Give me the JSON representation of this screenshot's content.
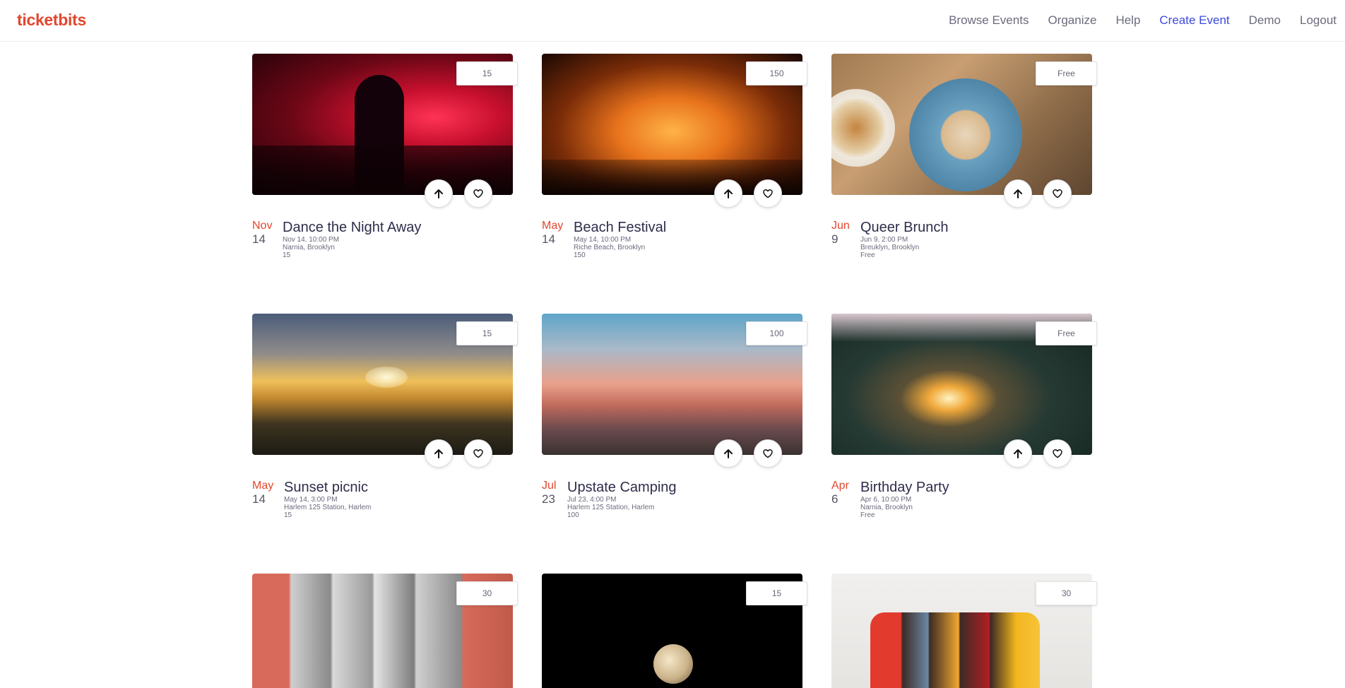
{
  "app": {
    "brand": "ticketbits"
  },
  "nav": {
    "items": [
      {
        "label": "Browse Events"
      },
      {
        "label": "Organize"
      },
      {
        "label": "Help"
      },
      {
        "label": "Create Event",
        "active": true
      },
      {
        "label": "Demo"
      },
      {
        "label": "Logout"
      }
    ]
  },
  "colors": {
    "brand": "#e2472f",
    "active_nav": "#3d4ad8",
    "title": "#2d2d4a"
  },
  "events": [
    {
      "month": "Nov",
      "day": "14",
      "title": "Dance the Night Away",
      "datetime": "Nov 14, 10:00 PM",
      "location": "Narnia, Brooklyn",
      "price": "15",
      "price_badge": "15"
    },
    {
      "month": "May",
      "day": "14",
      "title": "Beach Festival",
      "datetime": "May 14, 10:00 PM",
      "location": "Riche Beach, Brooklyn",
      "price": "150",
      "price_badge": "150"
    },
    {
      "month": "Jun",
      "day": "9",
      "title": "Queer Brunch",
      "datetime": "Jun 9, 2:00 PM",
      "location": "Breuklyn, Brooklyn",
      "price": "Free",
      "price_badge": "Free"
    },
    {
      "month": "May",
      "day": "14",
      "title": "Sunset picnic",
      "datetime": "May 14, 3:00 PM",
      "location": "Harlem 125 Station, Harlem",
      "price": "15",
      "price_badge": "15"
    },
    {
      "month": "Jul",
      "day": "23",
      "title": "Upstate Camping",
      "datetime": "Jul 23, 4:00 PM",
      "location": "Harlem 125 Station, Harlem",
      "price": "100",
      "price_badge": "100"
    },
    {
      "month": "Apr",
      "day": "6",
      "title": "Birthday Party",
      "datetime": "Apr 6, 10:00 PM",
      "location": "Narnia, Brooklyn",
      "price": "Free",
      "price_badge": "Free"
    },
    {
      "price_badge": "30"
    },
    {
      "price_badge": "15"
    },
    {
      "price_badge": "30"
    }
  ],
  "icons": {
    "upvote": "arrow-up-icon",
    "like": "heart-icon"
  }
}
